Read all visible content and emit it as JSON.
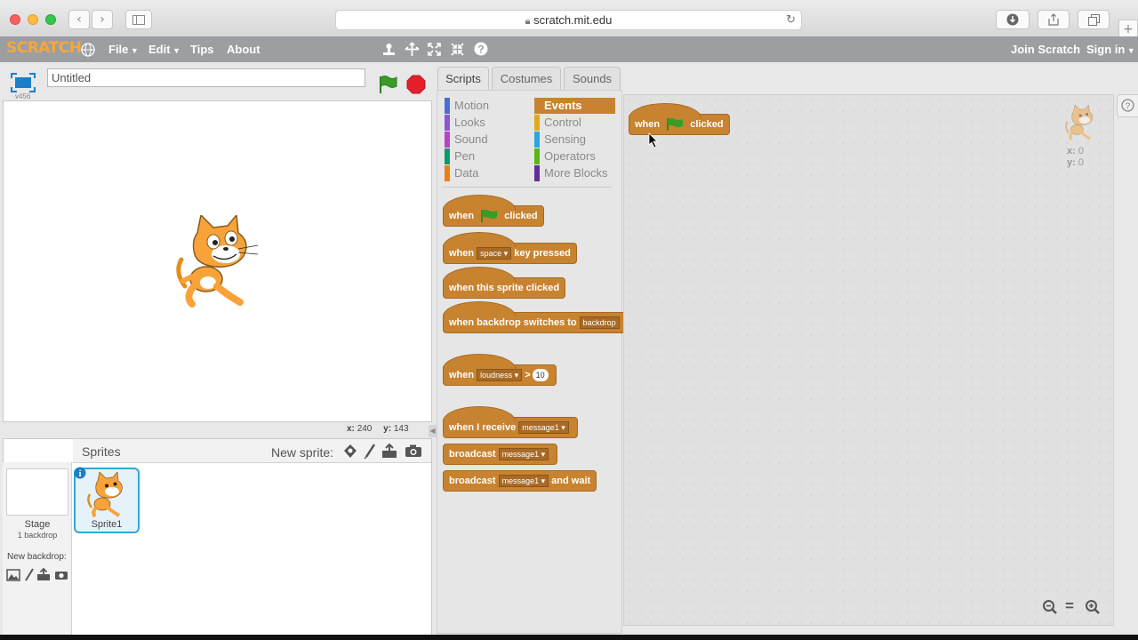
{
  "browser": {
    "url": "scratch.mit.edu"
  },
  "menubar": {
    "logo": "SCRATCH",
    "file": "File",
    "edit": "Edit",
    "tips": "Tips",
    "about": "About",
    "join": "Join Scratch",
    "signin": "Sign in"
  },
  "stage": {
    "project_title": "Untitled",
    "version": "v456",
    "coord_x_label": "x:",
    "coord_x": "240",
    "coord_y_label": "y:",
    "coord_y": "143"
  },
  "sprites": {
    "header": "Sprites",
    "new_sprite": "New sprite:",
    "stage_label": "Stage",
    "stage_backdrop": "1 backdrop",
    "new_backdrop": "New backdrop:",
    "sprite1": "Sprite1"
  },
  "tabs": [
    "Scripts",
    "Costumes",
    "Sounds"
  ],
  "categories": {
    "left": [
      "Motion",
      "Looks",
      "Sound",
      "Pen",
      "Data"
    ],
    "right": [
      "Events",
      "Control",
      "Sensing",
      "Operators",
      "More Blocks"
    ],
    "colors": {
      "Motion": "#4a6cd4",
      "Looks": "#8a55d7",
      "Sound": "#bb42c3",
      "Pen": "#0e9a6c",
      "Data": "#ee7d16",
      "Events": "#c88330",
      "Control": "#e1a91a",
      "Sensing": "#2ca5e2",
      "Operators": "#5cb712",
      "More Blocks": "#632d99"
    },
    "selected": "Events"
  },
  "blocks": {
    "when": "when",
    "clicked": "clicked",
    "space": "space",
    "key_pressed": "key pressed",
    "this_sprite_clicked": "when this sprite clicked",
    "backdrop_switches": "when backdrop switches to",
    "backdrop": "backdrop",
    "loudness": "loudness",
    "gt": ">",
    "ten": "10",
    "i_receive": "when I receive",
    "message1": "message1",
    "broadcast": "broadcast",
    "and_wait": "and wait"
  },
  "sprite_info": {
    "x_label": "x:",
    "x": "0",
    "y_label": "y:",
    "y": "0"
  },
  "zoom": {
    "equals": "="
  }
}
